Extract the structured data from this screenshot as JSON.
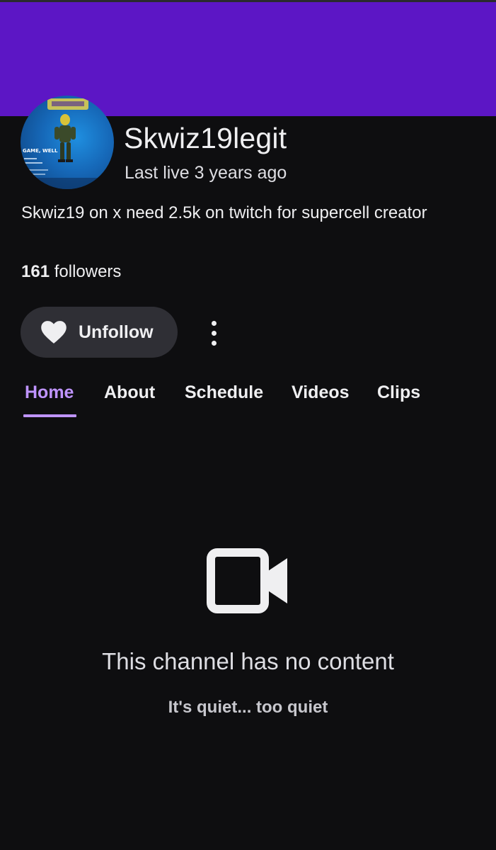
{
  "channel": {
    "name": "Skwiz19legit",
    "last_live": "Last live 3 years ago",
    "bio": "Skwiz19 on x need 2.5k on twitch for supercell creator",
    "followers_count": "161",
    "followers_label": "followers",
    "avatar_icon": "channel-avatar",
    "avatar_text": "GAME, WELL"
  },
  "actions": {
    "unfollow_label": "Unfollow",
    "unfollow_icon": "heart-icon",
    "more_icon": "more-vertical-icon"
  },
  "tabs": [
    {
      "label": "Home",
      "active": true
    },
    {
      "label": "About",
      "active": false
    },
    {
      "label": "Schedule",
      "active": false
    },
    {
      "label": "Videos",
      "active": false
    },
    {
      "label": "Clips",
      "active": false
    }
  ],
  "empty_state": {
    "icon": "video-camera-icon",
    "title": "This channel has no content",
    "subtitle": "It's quiet... too quiet"
  },
  "colors": {
    "background": "#0e0e10",
    "banner": "#5c16c5",
    "accent": "#bf94ff",
    "button_bg": "#2f2f35",
    "text": "#efeff1"
  }
}
